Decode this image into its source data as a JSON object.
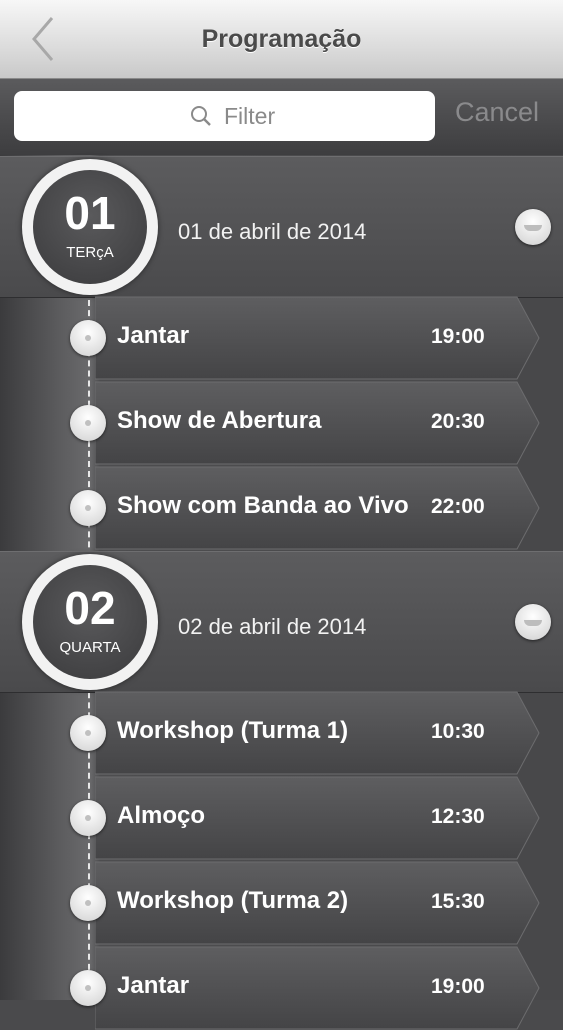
{
  "nav": {
    "title": "Programação",
    "back_icon": "chevron-left-icon"
  },
  "search": {
    "placeholder": "Filter",
    "value": "",
    "cancel_label": "Cancel",
    "icon": "search-icon"
  },
  "days": [
    {
      "number": "01",
      "weekday": "TERçA",
      "date": "01 de abril de 2014",
      "events": [
        {
          "name": "Jantar",
          "time": "19:00"
        },
        {
          "name": "Show de Abertura",
          "time": "20:30"
        },
        {
          "name": "Show com Banda ao Vivo",
          "time": "22:00"
        }
      ]
    },
    {
      "number": "02",
      "weekday": "QUARTA",
      "date": "02 de abril de 2014",
      "events": [
        {
          "name": "Workshop (Turma 1)",
          "time": "10:30"
        },
        {
          "name": "Almoço",
          "time": "12:30"
        },
        {
          "name": "Workshop (Turma 2)",
          "time": "15:30"
        },
        {
          "name": "Jantar",
          "time": "19:00"
        }
      ]
    }
  ]
}
